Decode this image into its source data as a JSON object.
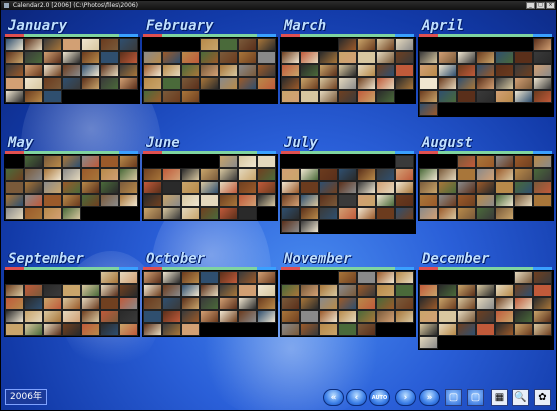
{
  "window": {
    "title": "Calendar2.0 [2006] (C:\\Photos\\files\\2006)"
  },
  "year_label": "2006年",
  "months": [
    {
      "name": "January",
      "offset": 0,
      "days": 31
    },
    {
      "name": "February",
      "offset": 3,
      "days": 28
    },
    {
      "name": "March",
      "offset": 3,
      "days": 31
    },
    {
      "name": "April",
      "offset": 6,
      "days": 30
    },
    {
      "name": "May",
      "offset": 1,
      "days": 31
    },
    {
      "name": "June",
      "offset": 4,
      "days": 30
    },
    {
      "name": "July",
      "offset": 6,
      "days": 31
    },
    {
      "name": "August",
      "offset": 2,
      "days": 31
    },
    {
      "name": "September",
      "offset": 5,
      "days": 30
    },
    {
      "name": "October",
      "offset": 0,
      "days": 31
    },
    {
      "name": "November",
      "offset": 3,
      "days": 30
    },
    {
      "name": "December",
      "offset": 5,
      "days": 31
    }
  ],
  "colors": {
    "sunday": "#e05050",
    "saturday": "#3aa0ff",
    "weekday": "#7fd4a0"
  },
  "controls": [
    {
      "name": "first-button",
      "icon": "«",
      "kind": "round"
    },
    {
      "name": "prev-button",
      "icon": "‹",
      "kind": "round"
    },
    {
      "name": "auto-button",
      "icon": "AUTO",
      "kind": "round"
    },
    {
      "name": "next-button",
      "icon": "›",
      "kind": "round"
    },
    {
      "name": "last-button",
      "icon": "»",
      "kind": "round"
    },
    {
      "name": "view-button-1",
      "icon": "▢",
      "kind": "square-blue"
    },
    {
      "name": "view-button-2",
      "icon": "▢",
      "kind": "square-blue"
    },
    {
      "name": "thumbnail-view-button",
      "icon": "▦",
      "kind": "square"
    },
    {
      "name": "search-button",
      "icon": "🔍",
      "kind": "square"
    },
    {
      "name": "settings-button",
      "icon": "✿",
      "kind": "square"
    }
  ]
}
